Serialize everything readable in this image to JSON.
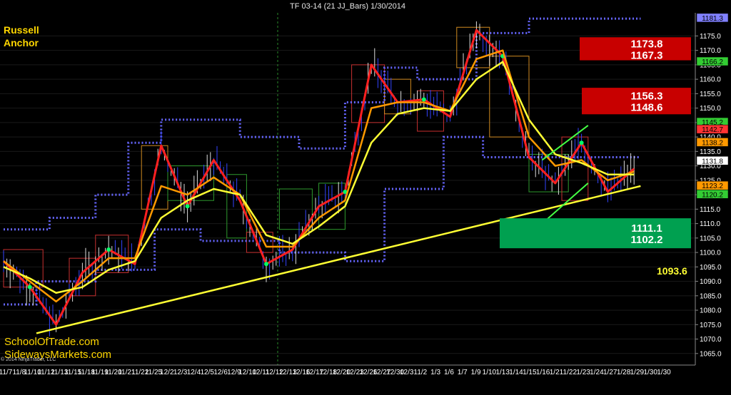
{
  "header": {
    "title": "TF 03-14 (21 JJ_Bars)  1/30/2014"
  },
  "corner_label": {
    "line1": "Russell",
    "line2": "Anchor"
  },
  "websites": [
    "SchoolOfTrade.com",
    "SidewaysMarkets.com"
  ],
  "copyright": "© 2014 NinjaTrader, LLC",
  "colors": {
    "background": "#000000",
    "grid": "#1a1a1a",
    "axis_text": "#ffffff",
    "yellow": "#ffff33",
    "orange": "#ff9900",
    "red_ma": "#ff2020",
    "green_ma": "#00c040",
    "dotted": "#6666ff",
    "resist_zone": "#c80000",
    "support_zone": "#00a050"
  },
  "chart_data": {
    "type": "line",
    "title": "TF 03-14 (21 JJ_Bars)  1/30/2014",
    "xlabel": "",
    "ylabel": "",
    "ylim": [
      1061,
      1183
    ],
    "y_ticks": [
      1065.0,
      1070.0,
      1075.0,
      1080.0,
      1085.0,
      1090.0,
      1095.0,
      1100.0,
      1105.0,
      1110.0,
      1115.0,
      1120.0,
      1125.0,
      1130.0,
      1135.0,
      1140.0,
      1145.0,
      1150.0,
      1155.0,
      1160.0,
      1165.0,
      1170.0,
      1175.0
    ],
    "x_tick_labels": [
      "11/7",
      "11/8",
      "11/10",
      "11/12",
      "11/13",
      "11/15",
      "11/18",
      "11/19",
      "11/20",
      "11/21",
      "11/22",
      "11/25",
      "12/2",
      "12/3",
      "12/4",
      "12/5",
      "12/6",
      "12/9",
      "12/10",
      "12/11",
      "12/12",
      "12/13",
      "12/16",
      "12/17",
      "12/18",
      "12/20",
      "12/23",
      "12/26",
      "12/27",
      "12/30",
      "12/31",
      "1/2",
      "1/3",
      "1/6",
      "1/7",
      "1/9",
      "1/10",
      "1/13",
      "1/14",
      "1/15",
      "1/16",
      "1/21",
      "1/22",
      "1/23",
      "1/24",
      "1/27",
      "1/28",
      "1/29",
      "1/30",
      "1/30"
    ],
    "series": [
      {
        "name": "",
        "x": [
          0,
          4,
          8,
          12,
          16,
          20,
          24,
          28,
          32,
          36,
          40,
          44,
          48,
          52,
          56,
          60,
          64,
          68,
          72,
          76,
          80,
          84,
          88,
          92,
          96
        ],
        "values": [
          1097,
          1088,
          1075,
          1093,
          1101,
          1096,
          1137,
          1116,
          1132,
          1118,
          1096,
          1101,
          1116,
          1121,
          1165,
          1152,
          1153,
          1147,
          1177,
          1168,
          1133,
          1124,
          1138,
          1121,
          1129
        ]
      },
      {
        "name": "",
        "x": [
          0,
          4,
          8,
          12,
          16,
          20,
          24,
          28,
          32,
          36,
          40,
          44,
          48,
          52,
          56,
          60,
          64,
          68,
          72,
          76,
          80,
          84,
          88,
          92,
          96
        ],
        "values": [
          1097,
          1090,
          1083,
          1090,
          1098,
          1098,
          1123,
          1120,
          1126,
          1120,
          1102,
          1102,
          1112,
          1118,
          1150,
          1152,
          1152,
          1149,
          1167,
          1170,
          1140,
          1130,
          1132,
          1125,
          1128
        ]
      },
      {
        "name": "",
        "x": [
          0,
          4,
          8,
          12,
          16,
          20,
          24,
          28,
          32,
          36,
          40,
          44,
          48,
          52,
          56,
          60,
          64,
          68,
          72,
          76,
          80,
          84,
          88,
          92,
          96
        ],
        "values": [
          1095,
          1091,
          1086,
          1088,
          1094,
          1097,
          1112,
          1118,
          1122,
          1120,
          1106,
          1103,
          1109,
          1116,
          1138,
          1148,
          1150,
          1149,
          1160,
          1166,
          1146,
          1134,
          1131,
          1127,
          1127
        ]
      }
    ],
    "trendline": {
      "x": [
        5,
        97
      ],
      "y": [
        1072,
        1123
      ]
    },
    "zones": [
      {
        "upper": 1173.8,
        "lower": 1167.3
      },
      {
        "upper": 1156.3,
        "lower": 1148.6
      },
      {
        "upper": 1111.1,
        "lower": 1102.2
      }
    ],
    "annotations": [
      "1093.6"
    ],
    "price_tags": [
      "1181.3",
      "1166.2",
      "1145.2",
      "1142.7",
      "1138.2",
      "1131.8",
      "1123.2",
      "1120.2"
    ]
  }
}
